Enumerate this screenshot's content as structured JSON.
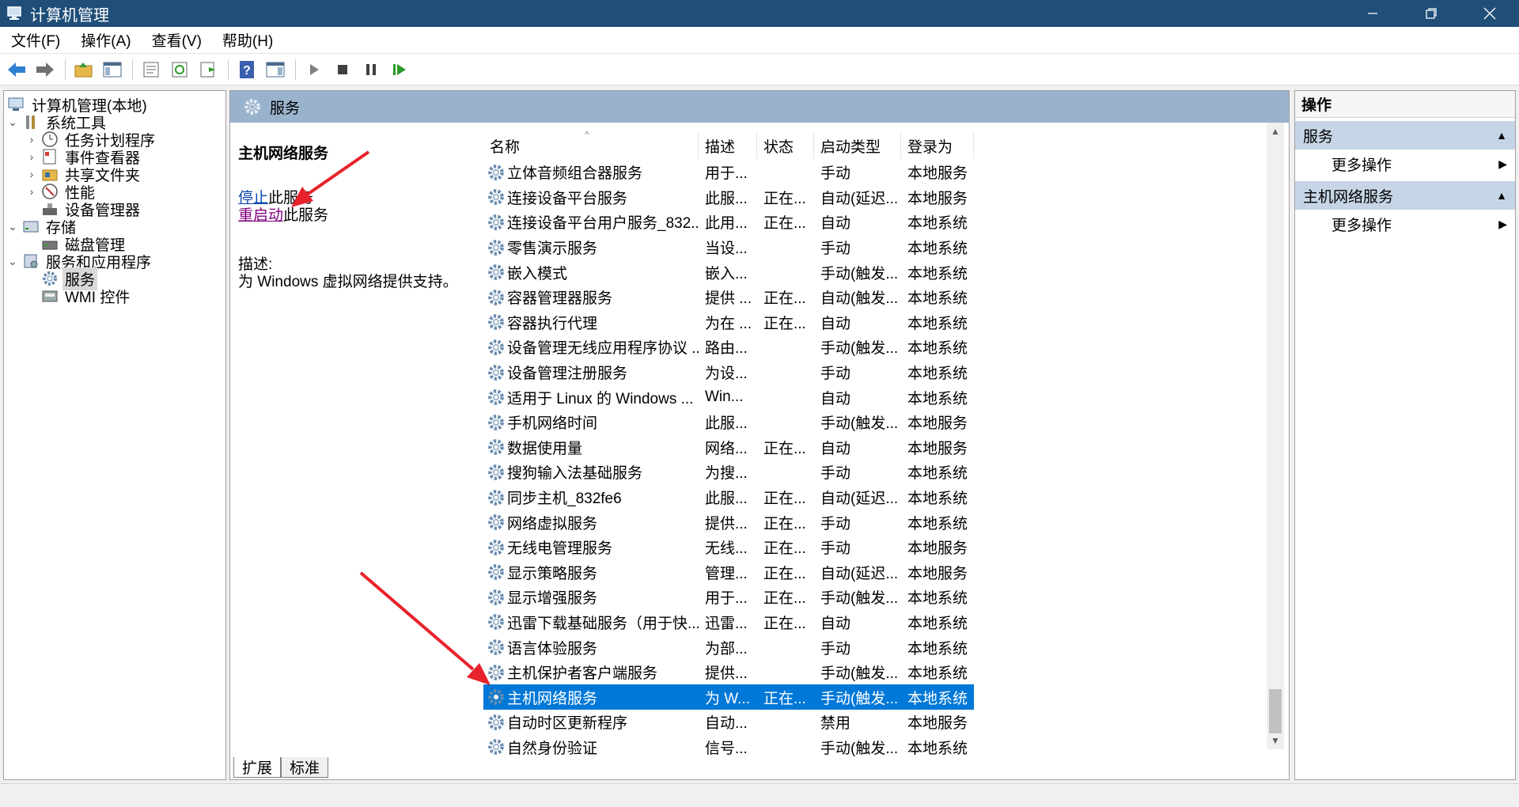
{
  "window": {
    "title": "计算机管理"
  },
  "menu": [
    "文件(F)",
    "操作(A)",
    "查看(V)",
    "帮助(H)"
  ],
  "toolbar": {
    "icons": [
      "back-icon",
      "forward-icon",
      "up-folder-icon",
      "show-hide-tree-icon",
      "properties-icon",
      "refresh-icon",
      "export-list-icon",
      "help-icon",
      "action-pane-icon",
      "start-service-icon",
      "stop-service-icon",
      "pause-service-icon",
      "resume-service-icon"
    ]
  },
  "tree": {
    "root": "计算机管理(本地)",
    "system_tools": "系统工具",
    "task_scheduler": "任务计划程序",
    "event_viewer": "事件查看器",
    "shared_folders": "共享文件夹",
    "performance": "性能",
    "device_manager": "设备管理器",
    "storage": "存储",
    "disk_management": "磁盘管理",
    "services_apps": "服务和应用程序",
    "services": "服务",
    "wmi": "WMI 控件"
  },
  "center": {
    "header": "服务",
    "selected_title": "主机网络服务",
    "stop_link": "停止",
    "stop_suffix": "此服务",
    "restart_link": "重启动",
    "restart_suffix": "此服务",
    "desc_label": "描述:",
    "desc_text": "为 Windows 虚拟网络提供支持。",
    "columns": [
      "名称",
      "描述",
      "状态",
      "启动类型",
      "登录为"
    ],
    "rows": [
      [
        "立体音频组合器服务",
        "用于...",
        "",
        "手动",
        "本地服务"
      ],
      [
        "连接设备平台服务",
        "此服...",
        "正在...",
        "自动(延迟...",
        "本地服务"
      ],
      [
        "连接设备平台用户服务_832...",
        "此用...",
        "正在...",
        "自动",
        "本地系统"
      ],
      [
        "零售演示服务",
        "当设...",
        "",
        "手动",
        "本地系统"
      ],
      [
        "嵌入模式",
        "嵌入...",
        "",
        "手动(触发...",
        "本地系统"
      ],
      [
        "容器管理器服务",
        "提供 ...",
        "正在...",
        "自动(触发...",
        "本地系统"
      ],
      [
        "容器执行代理",
        "为在 ...",
        "正在...",
        "自动",
        "本地系统"
      ],
      [
        "设备管理无线应用程序协议 ...",
        "路由...",
        "",
        "手动(触发...",
        "本地系统"
      ],
      [
        "设备管理注册服务",
        "为设...",
        "",
        "手动",
        "本地系统"
      ],
      [
        "适用于 Linux 的 Windows ...",
        "Win...",
        "",
        "自动",
        "本地系统"
      ],
      [
        "手机网络时间",
        "此服...",
        "",
        "手动(触发...",
        "本地服务"
      ],
      [
        "数据使用量",
        "网络...",
        "正在...",
        "自动",
        "本地服务"
      ],
      [
        "搜狗输入法基础服务",
        "为搜...",
        "",
        "手动",
        "本地系统"
      ],
      [
        "同步主机_832fe6",
        "此服...",
        "正在...",
        "自动(延迟...",
        "本地系统"
      ],
      [
        "网络虚拟服务",
        "提供...",
        "正在...",
        "手动",
        "本地系统"
      ],
      [
        "无线电管理服务",
        "无线...",
        "正在...",
        "手动",
        "本地服务"
      ],
      [
        "显示策略服务",
        "管理...",
        "正在...",
        "自动(延迟...",
        "本地服务"
      ],
      [
        "显示增强服务",
        "用于...",
        "正在...",
        "手动(触发...",
        "本地系统"
      ],
      [
        "迅雷下载基础服务（用于快...",
        "迅雷...",
        "正在...",
        "自动",
        "本地系统"
      ],
      [
        "语言体验服务",
        "为部...",
        "",
        "手动",
        "本地系统"
      ],
      [
        "主机保护者客户端服务",
        "提供...",
        "",
        "手动(触发...",
        "本地系统"
      ],
      [
        "主机网络服务",
        "为 W...",
        "正在...",
        "手动(触发...",
        "本地系统"
      ],
      [
        "自动时区更新程序",
        "自动...",
        "",
        "禁用",
        "本地服务"
      ],
      [
        "自然身份验证",
        "信号...",
        "",
        "手动(触发...",
        "本地系统"
      ]
    ],
    "selected_row_index": 21,
    "tabs": [
      "扩展",
      "标准"
    ]
  },
  "actions": {
    "header": "操作",
    "section1": "服务",
    "more1": "更多操作",
    "section2": "主机网络服务",
    "more2": "更多操作"
  },
  "colors": {
    "titlebar": "#1f4e79",
    "selection": "#0078d7",
    "section": "#c5d5e6",
    "annotation_arrow": "#e8222b"
  }
}
